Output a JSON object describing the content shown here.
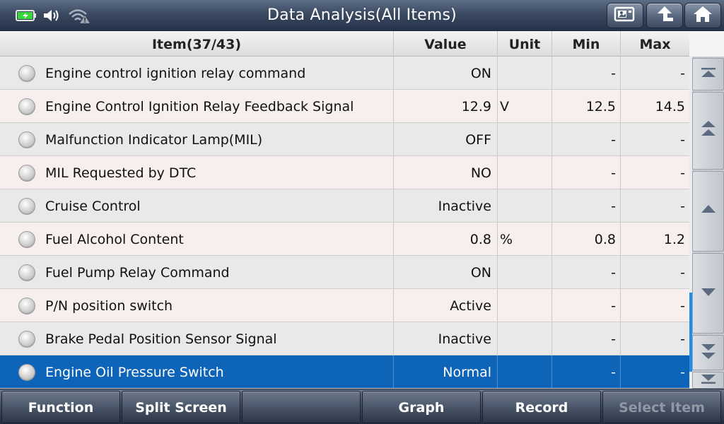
{
  "header": {
    "title": "Data Analysis(All Items)",
    "status_icons": [
      "battery-charging-icon",
      "speaker-icon",
      "wifi-warning-icon"
    ],
    "buttons": [
      "screenshot-icon",
      "back-icon",
      "home-icon"
    ],
    "battery_color": "#39d53b"
  },
  "table": {
    "columns": {
      "item": "Item(37/43)",
      "value": "Value",
      "unit": "Unit",
      "min": "Min",
      "max": "Max"
    },
    "rows": [
      {
        "name": "Engine control ignition relay command",
        "value": "ON",
        "unit": "",
        "min": "-",
        "max": "-"
      },
      {
        "name": "Engine Control Ignition Relay Feedback Signal",
        "value": "12.9",
        "unit": "V",
        "min": "12.5",
        "max": "14.5"
      },
      {
        "name": "Malfunction Indicator Lamp(MIL)",
        "value": "OFF",
        "unit": "",
        "min": "-",
        "max": "-"
      },
      {
        "name": "MIL Requested by DTC",
        "value": "NO",
        "unit": "",
        "min": "-",
        "max": "-"
      },
      {
        "name": "Cruise Control",
        "value": "Inactive",
        "unit": "",
        "min": "-",
        "max": "-"
      },
      {
        "name": "Fuel Alcohol Content",
        "value": "0.8",
        "unit": "%",
        "min": "0.8",
        "max": "1.2"
      },
      {
        "name": "Fuel Pump Relay Command",
        "value": "ON",
        "unit": "",
        "min": "-",
        "max": "-"
      },
      {
        "name": "P/N position switch",
        "value": "Active",
        "unit": "",
        "min": "-",
        "max": "-"
      },
      {
        "name": "Brake Pedal Position Sensor Signal",
        "value": "Inactive",
        "unit": "",
        "min": "-",
        "max": "-"
      },
      {
        "name": "Engine Oil Pressure Switch",
        "value": "Normal",
        "unit": "",
        "min": "-",
        "max": "-"
      }
    ],
    "selected_row": 9,
    "selection_color": "#0d64b8"
  },
  "scroll": {
    "buttons": [
      "scroll-top-icon",
      "page-up-icon",
      "line-up-icon",
      "line-down-icon",
      "page-down-icon",
      "scroll-bottom-icon"
    ],
    "thumb_start": 0.71,
    "thumb_end": 0.95,
    "accent": "#1f8fe8"
  },
  "toolbar": {
    "function_label": "Function",
    "split_screen_label": "Split Screen",
    "empty_label": "",
    "graph_label": "Graph",
    "record_label": "Record",
    "select_item_label": "Select Item"
  }
}
